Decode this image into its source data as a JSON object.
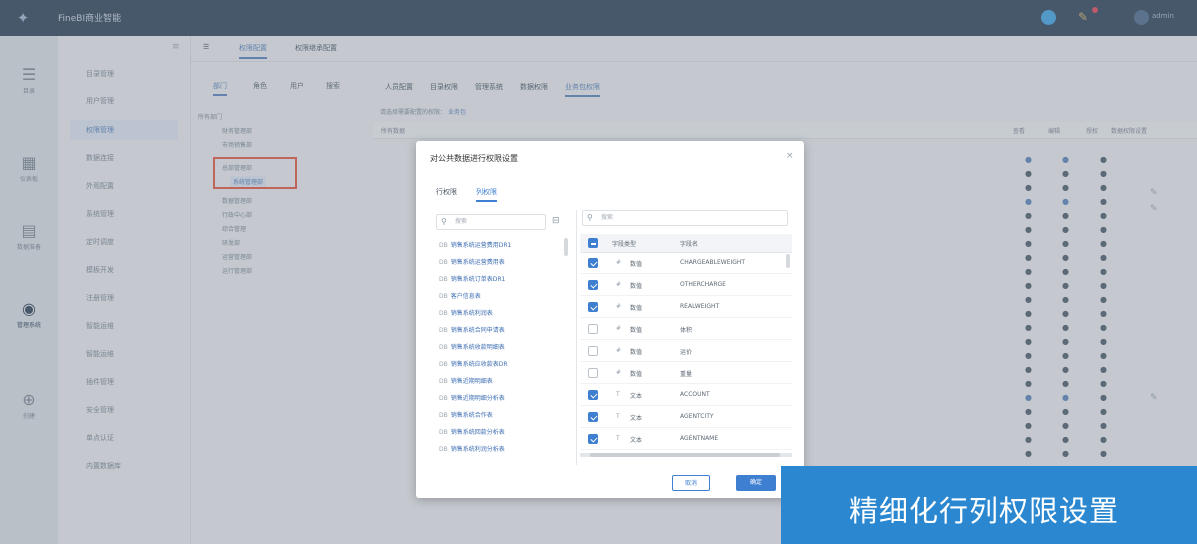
{
  "window": {
    "app_title": "FineBI商业智能",
    "user_name": "admin"
  },
  "rail": [
    {
      "label": "目录",
      "icon": "list-icon"
    },
    {
      "label": "仪表板",
      "icon": "grid-icon"
    },
    {
      "label": "数据准备",
      "icon": "database-icon"
    },
    {
      "label": "管理系统",
      "icon": "settings-icon"
    },
    {
      "label": "创建",
      "icon": "plus-icon"
    }
  ],
  "sidebar": {
    "items": [
      "目录管理",
      "用户管理",
      "权限管理",
      "数据连接",
      "外观配置",
      "系统管理",
      "定时调度",
      "模板开发",
      "注册管理",
      "智能运维",
      "智能运维",
      "插件管理",
      "安全管理",
      "单点认证",
      "内置数据库"
    ]
  },
  "top_tabs": [
    "权限配置",
    "权限继承配置"
  ],
  "permission_tabs": [
    "部门",
    "角色",
    "用户",
    "搜索"
  ],
  "resource_tabs": [
    "人员配置",
    "目录权限",
    "管理系统",
    "数据权限",
    "业务包权限"
  ],
  "tree": {
    "root": "所有部门",
    "nodes": [
      "财务管理部",
      "市场销售部",
      "总部管理部",
      "系统管理部",
      "数据管理部",
      "行政中心部",
      "综合管理",
      "研发部",
      "运营管理部",
      "运行管理部"
    ]
  },
  "breadcrumb": {
    "prefix": "请选择需要配置的权限：",
    "link": "业务包"
  },
  "table_headers": [
    "所有数据",
    "查看",
    "编辑",
    "授权",
    "数据权限设置"
  ],
  "dialog": {
    "title": "对公共数据进行权限设置",
    "tabs": [
      "行权限",
      "列权限"
    ],
    "left_search_placeholder": "搜索",
    "right_search_placeholder": "搜索",
    "tables": [
      "销售系统运营费用DR1",
      "销售系统运营费用表",
      "销售系统订单表DR1",
      "客户信息表",
      "销售系统利润表",
      "销售系统合同申请表",
      "销售系统收款明细表",
      "销售系统应收款表DR",
      "销售近期明细表",
      "销售近期明细分析表",
      "销售系统合作表",
      "销售系统回款分析表",
      "销售系统利润分析表"
    ],
    "field_headers": [
      "字段类型",
      "字段名"
    ],
    "fields": [
      {
        "checked": true,
        "type_icon": "#",
        "type": "数值",
        "name": "CHARGEABLEWEIGHT"
      },
      {
        "checked": true,
        "type_icon": "#",
        "type": "数值",
        "name": "OTHERCHARGE"
      },
      {
        "checked": true,
        "type_icon": "#",
        "type": "数值",
        "name": "REALWEIGHT"
      },
      {
        "checked": false,
        "type_icon": "#",
        "type": "数值",
        "name": "体积"
      },
      {
        "checked": false,
        "type_icon": "#",
        "type": "数值",
        "name": "运价"
      },
      {
        "checked": false,
        "type_icon": "#",
        "type": "数值",
        "name": "重量"
      },
      {
        "checked": true,
        "type_icon": "T",
        "type": "文本",
        "name": "ACCOUNT"
      },
      {
        "checked": true,
        "type_icon": "T",
        "type": "文本",
        "name": "AGENTCITY"
      },
      {
        "checked": true,
        "type_icon": "T",
        "type": "文本",
        "name": "AGENTNAME"
      }
    ],
    "cancel_label": "取消",
    "ok_label": "确定"
  },
  "banner": {
    "text": "精细化行列权限设置"
  },
  "colors": {
    "accent": "#3f7fd1",
    "topbar": "#2f4359",
    "banner": "#2a87d0",
    "highlight_box": "#e5573f"
  }
}
